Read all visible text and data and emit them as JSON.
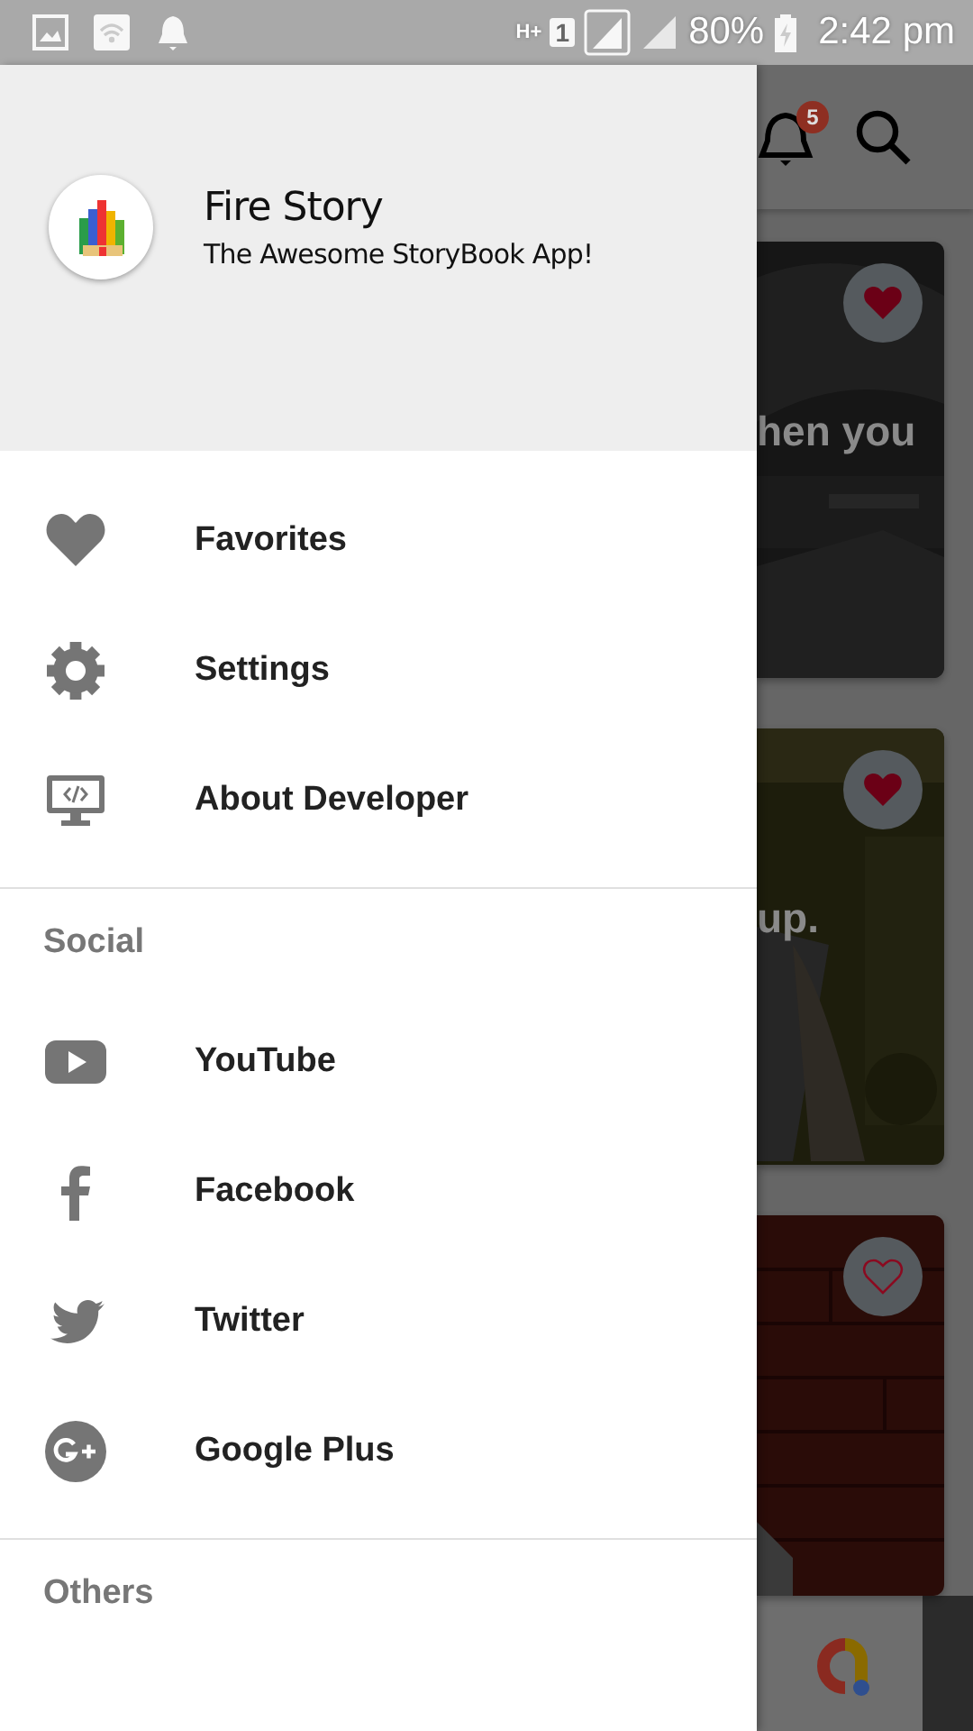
{
  "status_bar": {
    "network": "H+",
    "sim": "1",
    "battery": "80%",
    "time": "2:42 pm"
  },
  "drawer": {
    "header": {
      "title": "Fire Story",
      "subtitle": "The Awesome StoryBook App!"
    },
    "items": [
      {
        "label": "Favorites"
      },
      {
        "label": "Settings"
      },
      {
        "label": "About Developer"
      }
    ],
    "sections": [
      {
        "title": "Social",
        "items": [
          {
            "label": "YouTube"
          },
          {
            "label": "Facebook"
          },
          {
            "label": "Twitter"
          },
          {
            "label": "Google Plus"
          }
        ]
      },
      {
        "title": "Others"
      }
    ]
  },
  "background": {
    "notification_count": "5",
    "cards": [
      {
        "caption": "hen you",
        "favorite": true
      },
      {
        "caption": "up.",
        "favorite": true
      },
      {
        "favorite": false
      }
    ]
  }
}
